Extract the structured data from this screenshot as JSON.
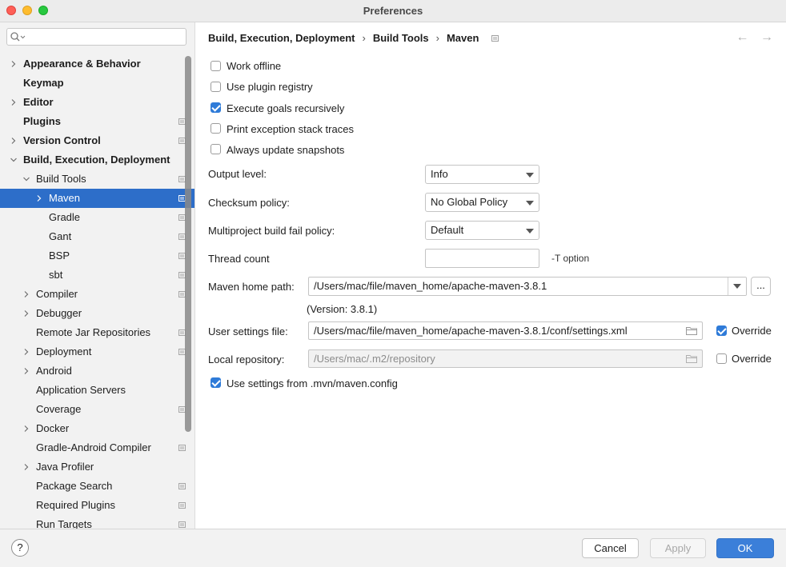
{
  "window": {
    "title": "Preferences"
  },
  "search": {
    "placeholder": ""
  },
  "tree": [
    {
      "label": "Appearance & Behavior",
      "level": 0,
      "bold": true,
      "chevron": "right",
      "project": false,
      "selected": false
    },
    {
      "label": "Keymap",
      "level": 0,
      "bold": true,
      "chevron": "none",
      "project": false,
      "selected": false
    },
    {
      "label": "Editor",
      "level": 0,
      "bold": true,
      "chevron": "right",
      "project": false,
      "selected": false
    },
    {
      "label": "Plugins",
      "level": 0,
      "bold": true,
      "chevron": "none",
      "project": true,
      "selected": false
    },
    {
      "label": "Version Control",
      "level": 0,
      "bold": true,
      "chevron": "right",
      "project": true,
      "selected": false
    },
    {
      "label": "Build, Execution, Deployment",
      "level": 0,
      "bold": true,
      "chevron": "down",
      "project": false,
      "selected": false
    },
    {
      "label": "Build Tools",
      "level": 1,
      "bold": false,
      "chevron": "down",
      "project": true,
      "selected": false
    },
    {
      "label": "Maven",
      "level": 2,
      "bold": false,
      "chevron": "right",
      "project": true,
      "selected": true
    },
    {
      "label": "Gradle",
      "level": 2,
      "bold": false,
      "chevron": "none",
      "project": true,
      "selected": false
    },
    {
      "label": "Gant",
      "level": 2,
      "bold": false,
      "chevron": "none",
      "project": true,
      "selected": false
    },
    {
      "label": "BSP",
      "level": 2,
      "bold": false,
      "chevron": "none",
      "project": true,
      "selected": false
    },
    {
      "label": "sbt",
      "level": 2,
      "bold": false,
      "chevron": "none",
      "project": true,
      "selected": false
    },
    {
      "label": "Compiler",
      "level": 1,
      "bold": false,
      "chevron": "right",
      "project": true,
      "selected": false
    },
    {
      "label": "Debugger",
      "level": 1,
      "bold": false,
      "chevron": "right",
      "project": false,
      "selected": false
    },
    {
      "label": "Remote Jar Repositories",
      "level": 1,
      "bold": false,
      "chevron": "none",
      "project": true,
      "selected": false
    },
    {
      "label": "Deployment",
      "level": 1,
      "bold": false,
      "chevron": "right",
      "project": true,
      "selected": false
    },
    {
      "label": "Android",
      "level": 1,
      "bold": false,
      "chevron": "right",
      "project": false,
      "selected": false
    },
    {
      "label": "Application Servers",
      "level": 1,
      "bold": false,
      "chevron": "none",
      "project": false,
      "selected": false
    },
    {
      "label": "Coverage",
      "level": 1,
      "bold": false,
      "chevron": "none",
      "project": true,
      "selected": false
    },
    {
      "label": "Docker",
      "level": 1,
      "bold": false,
      "chevron": "right",
      "project": false,
      "selected": false
    },
    {
      "label": "Gradle-Android Compiler",
      "level": 1,
      "bold": false,
      "chevron": "none",
      "project": true,
      "selected": false
    },
    {
      "label": "Java Profiler",
      "level": 1,
      "bold": false,
      "chevron": "right",
      "project": false,
      "selected": false
    },
    {
      "label": "Package Search",
      "level": 1,
      "bold": false,
      "chevron": "none",
      "project": true,
      "selected": false
    },
    {
      "label": "Required Plugins",
      "level": 1,
      "bold": false,
      "chevron": "none",
      "project": true,
      "selected": false
    },
    {
      "label": "Run Targets",
      "level": 1,
      "bold": false,
      "chevron": "none",
      "project": true,
      "selected": false
    }
  ],
  "breadcrumb": {
    "items": [
      "Build, Execution, Deployment",
      "Build Tools",
      "Maven"
    ],
    "separator": "›"
  },
  "nav": {
    "back": "←",
    "forward": "→"
  },
  "checkboxes": {
    "work_offline": {
      "label": "Work offline",
      "checked": false
    },
    "plugin_registry": {
      "label": "Use plugin registry",
      "checked": false
    },
    "recursive": {
      "label": "Execute goals recursively",
      "checked": true
    },
    "stack_traces": {
      "label": "Print exception stack traces",
      "checked": false
    },
    "snapshots": {
      "label": "Always update snapshots",
      "checked": false
    },
    "mvn_config": {
      "label": "Use settings from .mvn/maven.config",
      "checked": true
    }
  },
  "fields": {
    "output_level": {
      "label": "Output level:",
      "value": "Info"
    },
    "checksum": {
      "label": "Checksum policy:",
      "value": "No Global Policy"
    },
    "fail_policy": {
      "label": "Multiproject build fail policy:",
      "value": "Default"
    },
    "thread_count": {
      "label": "Thread count",
      "value": "",
      "hint": "-T option"
    },
    "maven_home": {
      "label": "Maven home path:",
      "value": "/Users/mac/file/maven_home/apache-maven-3.8.1",
      "browse": "...",
      "version": "(Version: 3.8.1)"
    },
    "user_settings": {
      "label": "User settings file:",
      "value": "/Users/mac/file/maven_home/apache-maven-3.8.1/conf/settings.xml",
      "override_label": "Override",
      "override": true
    },
    "local_repo": {
      "label": "Local repository:",
      "value": "/Users/mac/.m2/repository",
      "override_label": "Override",
      "override": false
    }
  },
  "footer": {
    "help": "?",
    "cancel": "Cancel",
    "apply": "Apply",
    "ok": "OK"
  },
  "colors": {
    "accent": "#2d6ec9",
    "ok_button": "#3b7fd9",
    "close": "#fe5f57",
    "minimize": "#febc2e",
    "zoom": "#28c840"
  }
}
